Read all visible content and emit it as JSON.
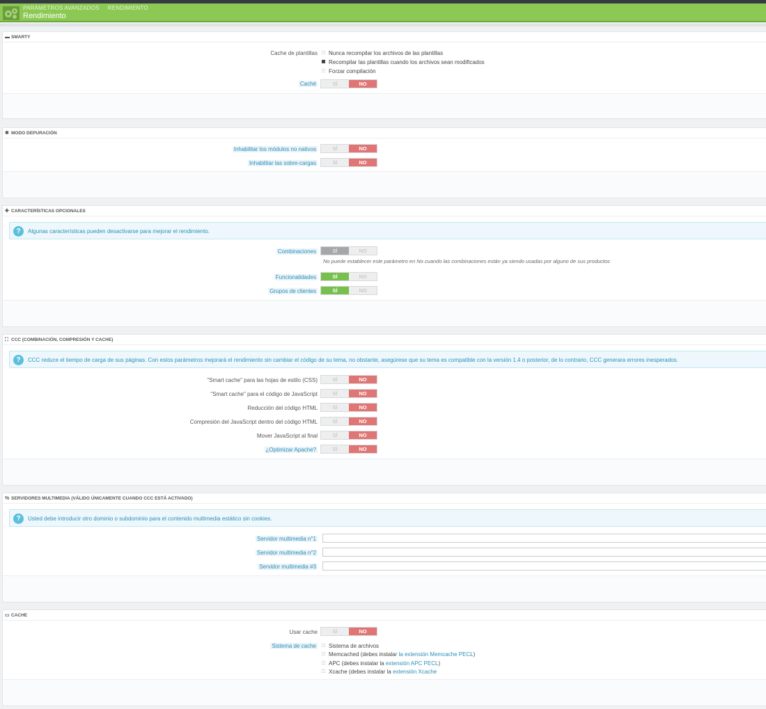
{
  "header": {
    "breadcrumb": [
      "PARÁMETROS AVANZADOS",
      "RENDIMIENTO"
    ],
    "title": "Rendimiento"
  },
  "colors": {
    "header_bg": "#8bc954",
    "switch_no_active": "#e07575",
    "switch_yes_active": "#78c04e",
    "help_blue": "#2a8fb8"
  },
  "smarty": {
    "heading": "SMARTY",
    "heading_icon": "camera-icon",
    "template_cache_label": "Cache de plantillas",
    "template_cache_options": [
      {
        "label": "Nunca recompilar los archivos de las plantillas",
        "checked": false
      },
      {
        "label": "Recompilar las plantillas cuando los archivos sean modificados",
        "checked": true
      },
      {
        "label": "Forzar compilación",
        "checked": false
      }
    ],
    "cache_label": "Caché",
    "cache_value": "NO"
  },
  "debug": {
    "heading": "MODO DEPURACIÓN",
    "heading_icon": "bug-icon",
    "rows": [
      {
        "label": "Inhabilitar los módulos no nativos",
        "value": "NO"
      },
      {
        "label": "Inhabilitar las sobre-cargas",
        "value": "NO"
      }
    ]
  },
  "optional": {
    "heading": "CARACTERÍSTICAS OPCIONALES",
    "heading_icon": "puzzle-icon",
    "info": "Algunas características pueden desactivarse para mejorar el rendimiento.",
    "combinations_label": "Combinaciones",
    "combinations_value": "SÍ",
    "combinations_note": "No puede establecer este parámetro en No cuando las combinaciones están ya siendo usadas por alguno de sus productos",
    "features_label": "Funcionalidades",
    "features_value": "SÍ",
    "groups_label": "Grupos de clientes",
    "groups_value": "SÍ"
  },
  "ccc": {
    "heading": "CCC (COMBINACIÓN, COMPRESIÓN Y CACHE)",
    "heading_icon": "fullscreen-icon",
    "info": "CCC reduce el tiempo de carga de sus páginas. Con estos parámetros mejorará el rendimiento sin cambiar el código de su tema, no obstante, asegúrese que su tema es compatible con la versión 1.4 o posterior, de lo contrario, CCC generara errores inesperados.",
    "rows": [
      {
        "label": "\"Smart cache\" para las hojas de estilo (CSS)",
        "value": "NO"
      },
      {
        "label": "\"Smart cache\" para el código de JavaScript",
        "value": "NO"
      },
      {
        "label": "Reducción del código HTML",
        "value": "NO"
      },
      {
        "label": "Compresión del JavaScript dentro del código HTML",
        "value": "NO"
      },
      {
        "label": "Mover JavaScript al final",
        "value": "NO"
      },
      {
        "label": "¿Optimizar Apache?",
        "value": "NO"
      }
    ]
  },
  "media": {
    "heading": "SERVIDORES MULTIMEDIA (VÁLIDO ÚNICAMENTE CUANDO CCC ESTÁ ACTIVADO)",
    "heading_icon": "link-icon",
    "info": "Usted debe introducir otro dominio o subdominio para el contenido multimedia estático sin cookies.",
    "servers": [
      {
        "label": "Servidor multimedia n°1",
        "value": ""
      },
      {
        "label": "Servidor multimedia n°2",
        "value": ""
      },
      {
        "label": "Servidor multimedia #3",
        "value": ""
      }
    ]
  },
  "cache": {
    "heading": "CACHE",
    "heading_icon": "monitor-icon",
    "use_cache_label": "Usar cache",
    "use_cache_value": "NO",
    "system_label": "Sistema de cache",
    "systems": [
      {
        "text": "Sistema de archivos",
        "link": "",
        "suffix": ""
      },
      {
        "text": "Memcached (debes instalar ",
        "link": "la extensión Memcache PECL",
        "suffix": ")"
      },
      {
        "text": "APC (debes instalar la ",
        "link": "extensión APC PECL",
        "suffix": ")"
      },
      {
        "text": "Xcache (debes instalar la ",
        "link": "extensión Xcache",
        "suffix": ""
      }
    ]
  },
  "switch_labels": {
    "yes": "SÍ",
    "no": "NO"
  }
}
